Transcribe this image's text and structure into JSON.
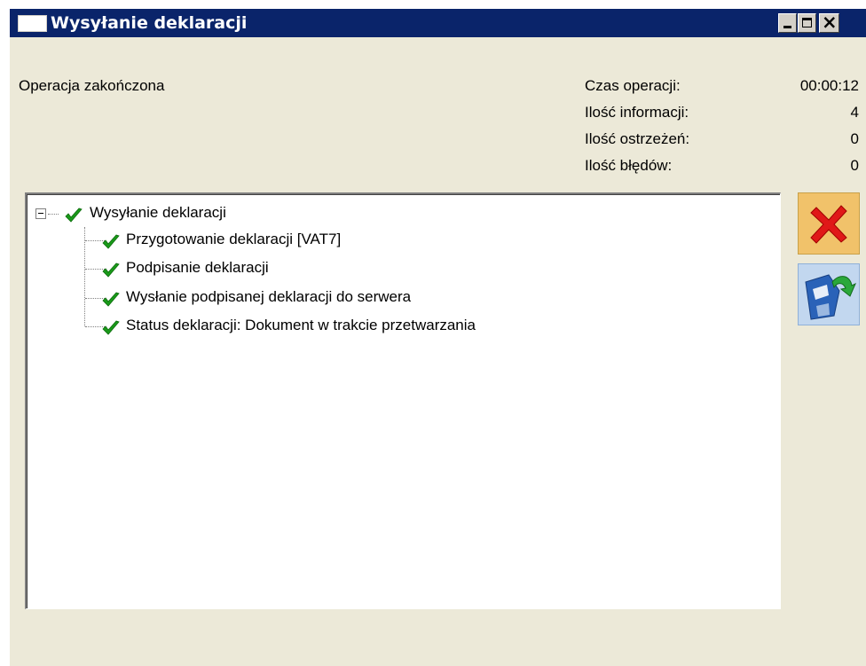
{
  "window": {
    "title": "Wysyłanie deklaracji",
    "title_icon": "window-app-icon",
    "controls": {
      "minimize": "minimize-icon",
      "maximize": "maximize-icon",
      "close": "close-icon"
    },
    "colors": {
      "titlebar": "#0a246a",
      "window_bg": "#ece9d8"
    }
  },
  "status": {
    "message": "Operacja zakończona"
  },
  "stats": [
    {
      "label": "Czas operacji:",
      "value": "00:00:12"
    },
    {
      "label": "Ilość informacji:",
      "value": "4"
    },
    {
      "label": "Ilość ostrzeżeń:",
      "value": "0"
    },
    {
      "label": "Ilość błędów:",
      "value": "0"
    }
  ],
  "tree": {
    "root": {
      "label": "Wysyłanie deklaracji",
      "icon": "check-icon",
      "expanded": true
    },
    "children": [
      {
        "label": "Przygotowanie deklaracji [VAT7]",
        "icon": "check-icon"
      },
      {
        "label": "Podpisanie deklaracji",
        "icon": "check-icon"
      },
      {
        "label": "Wysłanie podpisanej deklaracji do serwera",
        "icon": "check-icon"
      },
      {
        "label": "Status deklaracji: Dokument w trakcie przetwarzania",
        "icon": "check-icon"
      }
    ]
  },
  "actions": {
    "close": {
      "icon": "red-x-icon",
      "color": "#f1c26a"
    },
    "save": {
      "icon": "floppy-save-icon",
      "color": "#c2d7ef"
    }
  }
}
